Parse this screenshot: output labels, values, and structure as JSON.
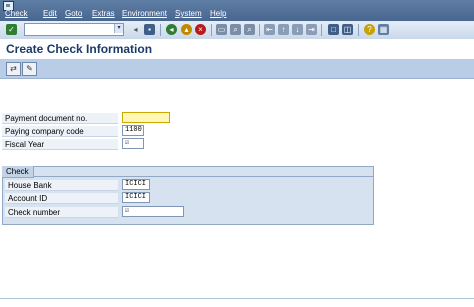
{
  "menu": [
    "Check",
    "Edit",
    "Goto",
    "Extras",
    "Environment",
    "System",
    "Help"
  ],
  "toolbar": {
    "command_value": ""
  },
  "title": "Create Check Information",
  "form": {
    "payment_document": {
      "label": "Payment document no.",
      "value": ""
    },
    "paying_company_code": {
      "label": "Paying company code",
      "value": "1100"
    },
    "fiscal_year": {
      "label": "Fiscal Year",
      "value": "☑"
    }
  },
  "check_group": {
    "title": "Check",
    "house_bank": {
      "label": "House Bank",
      "value": "ICICI"
    },
    "account_id": {
      "label": "Account ID",
      "value": "ICICI"
    },
    "check_number": {
      "label": "Check number",
      "value": "☑"
    }
  },
  "icons": {
    "enter": "checkmark-icon",
    "save": "save-icon",
    "back": "back-icon",
    "exit": "exit-icon",
    "cancel": "cancel-icon",
    "print": "print-icon",
    "find": "find-icon",
    "find_next": "find-next-icon",
    "first_page": "first-page-icon",
    "previous_page": "previous-page-icon",
    "next_page": "next-page-icon",
    "last_page": "last-page-icon",
    "create_session": "create-session-icon",
    "shortcut": "shortcut-icon",
    "help": "help-icon",
    "customize": "customize-layout-icon",
    "display_change": "display-change-icon",
    "edit": "pencil-icon"
  },
  "colors": {
    "menubar": "#48668f",
    "title": "#1b3a68",
    "required_field": "#fff6b8",
    "group_bg": "#d6e2f0"
  }
}
